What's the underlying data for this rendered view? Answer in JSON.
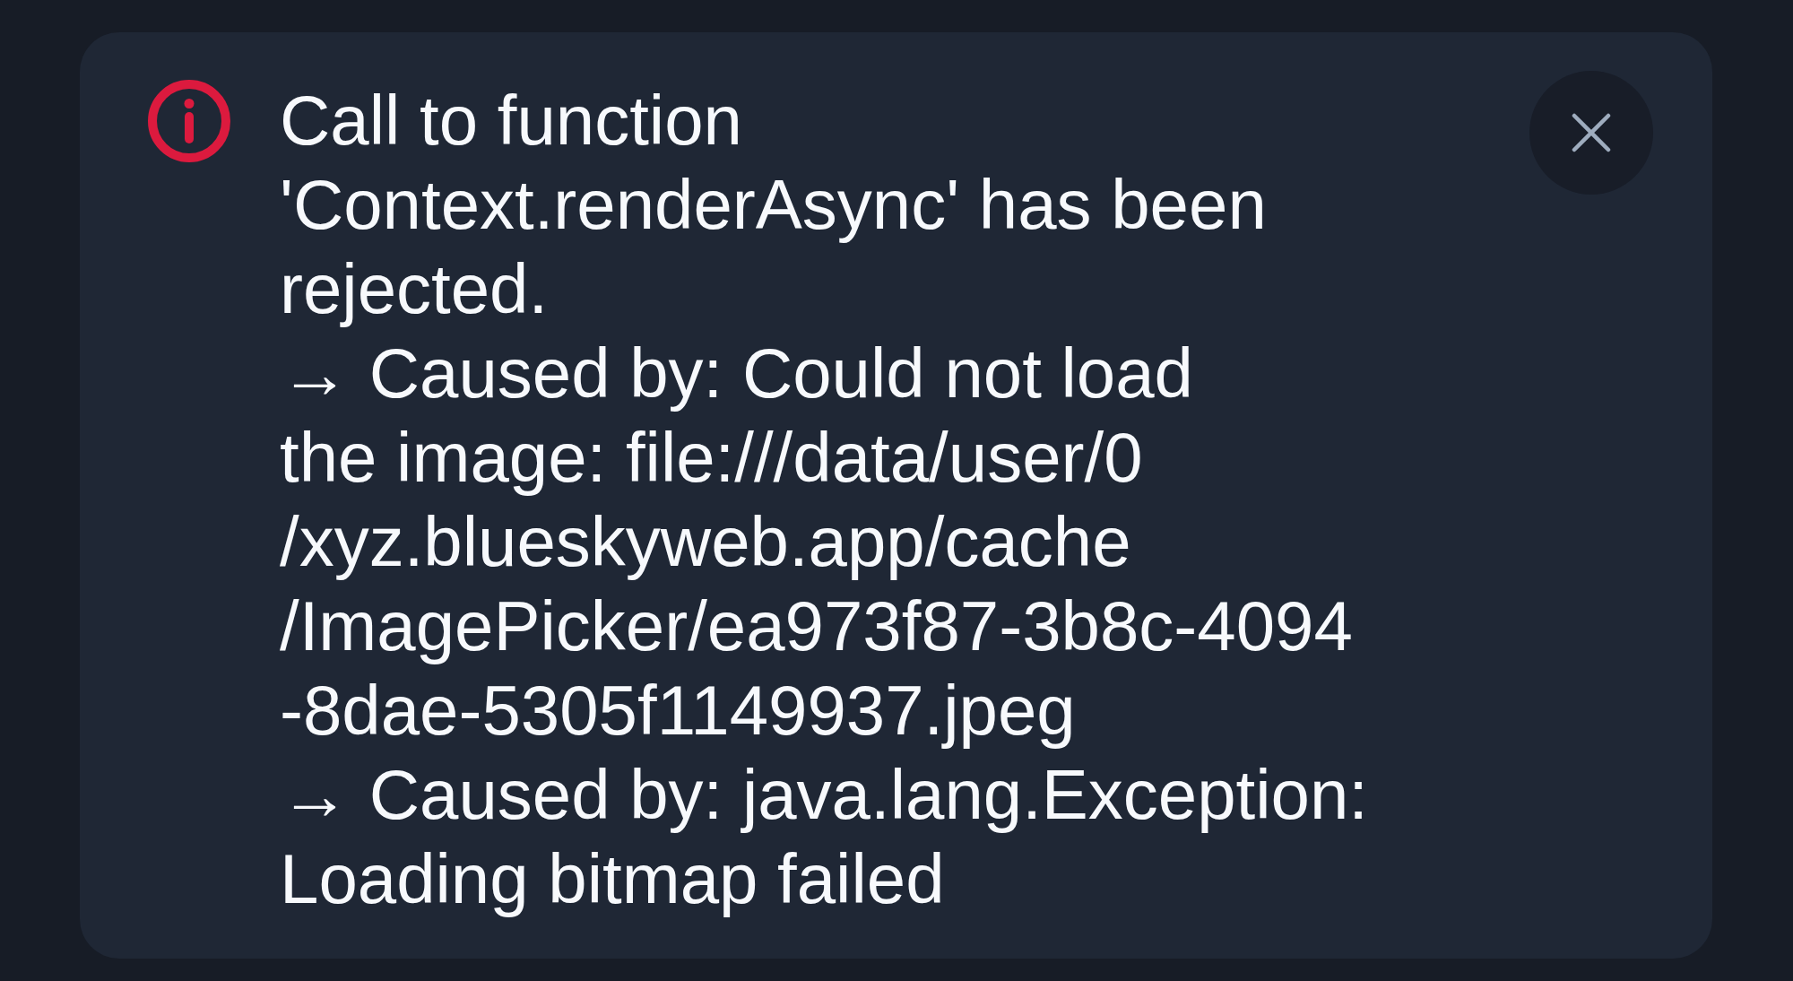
{
  "alert": {
    "message": "Call to function\n'Context.renderAsync' has been\nrejected.\n→ Caused by: Could not load\nthe image: file:///data/user/0\n/xyz.blueskyweb.app/cache\n/ImagePicker/ea973f87-3b8c-4094\n-8dae-5305f1149937.jpeg\n→ Caused by: java.lang.Exception:\nLoading bitmap failed",
    "dismissible": true
  }
}
